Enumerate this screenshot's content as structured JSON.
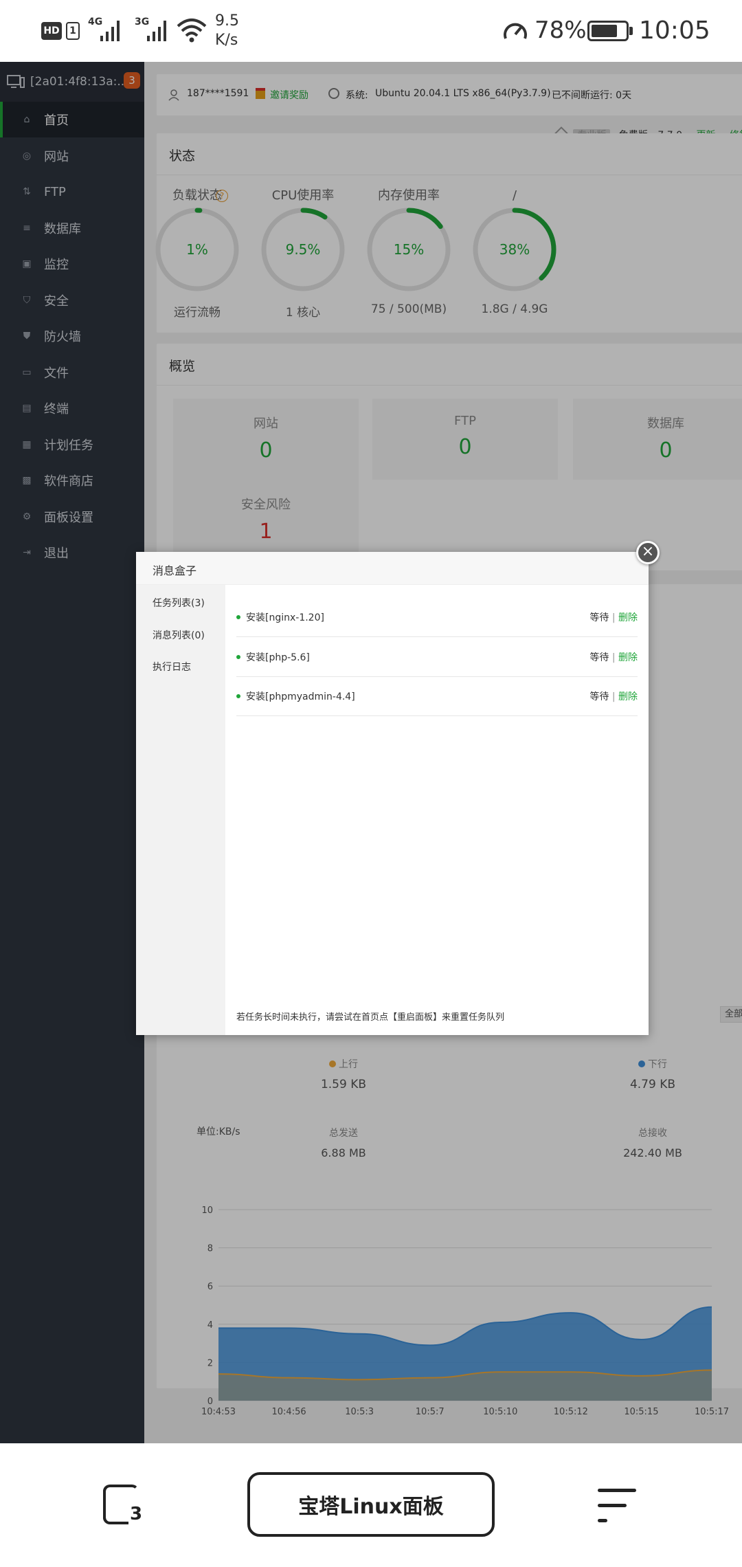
{
  "status_bar": {
    "hd": "HD",
    "sim": "1",
    "net1": "4G",
    "net2": "3G",
    "speed": "9.5",
    "speed_unit": "K/s",
    "battery": "78%",
    "time": "10:05"
  },
  "sidebar": {
    "host": "[2a01:4f8:13a:...",
    "badge": "3",
    "items": [
      {
        "label": "首页",
        "icon": "home-icon"
      },
      {
        "label": "网站",
        "icon": "globe-icon"
      },
      {
        "label": "FTP",
        "icon": "ftp-icon"
      },
      {
        "label": "数据库",
        "icon": "database-icon"
      },
      {
        "label": "监控",
        "icon": "monitor-icon"
      },
      {
        "label": "安全",
        "icon": "shield-icon"
      },
      {
        "label": "防火墙",
        "icon": "firewall-icon"
      },
      {
        "label": "文件",
        "icon": "folder-icon"
      },
      {
        "label": "终端",
        "icon": "terminal-icon"
      },
      {
        "label": "计划任务",
        "icon": "calendar-icon"
      },
      {
        "label": "软件商店",
        "icon": "apps-icon"
      },
      {
        "label": "面板设置",
        "icon": "gear-icon"
      },
      {
        "label": "退出",
        "icon": "logout-icon"
      }
    ]
  },
  "header": {
    "user": "187****1591",
    "invite": "邀请奖励",
    "system_label": "系统:",
    "system": "Ubuntu 20.04.1 LTS x86_64(Py3.7.9)",
    "uptime": "已不间断运行: 0天"
  },
  "version_row": {
    "pro": "专业版",
    "free": "免费版",
    "version": "7.7.0",
    "update": "更新",
    "repair": "修复",
    "restart": "重"
  },
  "status_card": {
    "title": "状态",
    "gauges": [
      {
        "title": "负载状态",
        "value": "1%",
        "sub": "运行流畅",
        "ratio": 0.01
      },
      {
        "title": "CPU使用率",
        "value": "9.5%",
        "sub": "1 核心",
        "ratio": 0.095
      },
      {
        "title": "内存使用率",
        "value": "15%",
        "sub": "75 / 500(MB)",
        "ratio": 0.15
      },
      {
        "title": "/",
        "value": "38%",
        "sub": "1.8G / 4.9G",
        "ratio": 0.38
      }
    ]
  },
  "overview": {
    "title": "概览",
    "items": [
      {
        "label": "网站",
        "value": "0"
      },
      {
        "label": "FTP",
        "value": "0"
      },
      {
        "label": "数据库",
        "value": "0"
      },
      {
        "label": "安全风险",
        "value": "1"
      }
    ]
  },
  "traffic": {
    "all_btn": "全部",
    "up_label": "上行",
    "up_value": "1.59 KB",
    "down_label": "下行",
    "down_value": "4.79 KB",
    "sent_label": "总发送",
    "sent_value": "6.88 MB",
    "recv_label": "总接收",
    "recv_value": "242.40 MB",
    "unit": "单位:KB/s",
    "colors": {
      "up": "#f0a93a",
      "down": "#3e8fd9"
    }
  },
  "chart_data": {
    "type": "area",
    "ylim": [
      0,
      10
    ],
    "yticks": [
      0,
      2,
      4,
      6,
      8,
      10
    ],
    "x": [
      "10:4:53",
      "10:4:56",
      "10:5:3",
      "10:5:7",
      "10:5:10",
      "10:5:12",
      "10:5:15",
      "10:5:17"
    ],
    "series": [
      {
        "name": "下行",
        "values": [
          3.8,
          3.8,
          3.5,
          2.9,
          4.1,
          4.6,
          3.2,
          4.9
        ]
      },
      {
        "name": "上行",
        "values": [
          1.4,
          1.2,
          1.1,
          1.2,
          1.5,
          1.5,
          1.3,
          1.6
        ]
      }
    ]
  },
  "modal": {
    "title": "消息盒子",
    "tabs": [
      "任务列表(3)",
      "消息列表(0)",
      "执行日志"
    ],
    "tasks": [
      {
        "name": "安装[nginx-1.20]",
        "state": "等待",
        "sep": "|",
        "action": "删除"
      },
      {
        "name": "安装[php-5.6]",
        "state": "等待",
        "sep": "|",
        "action": "删除"
      },
      {
        "name": "安装[phpmyadmin-4.4]",
        "state": "等待",
        "sep": "|",
        "action": "删除"
      }
    ],
    "footer": "若任务长时间未执行，请尝试在首页点【重启面板】来重置任务队列"
  },
  "nav_bar": {
    "title": "宝塔Linux面板",
    "tabs_count": "3"
  }
}
